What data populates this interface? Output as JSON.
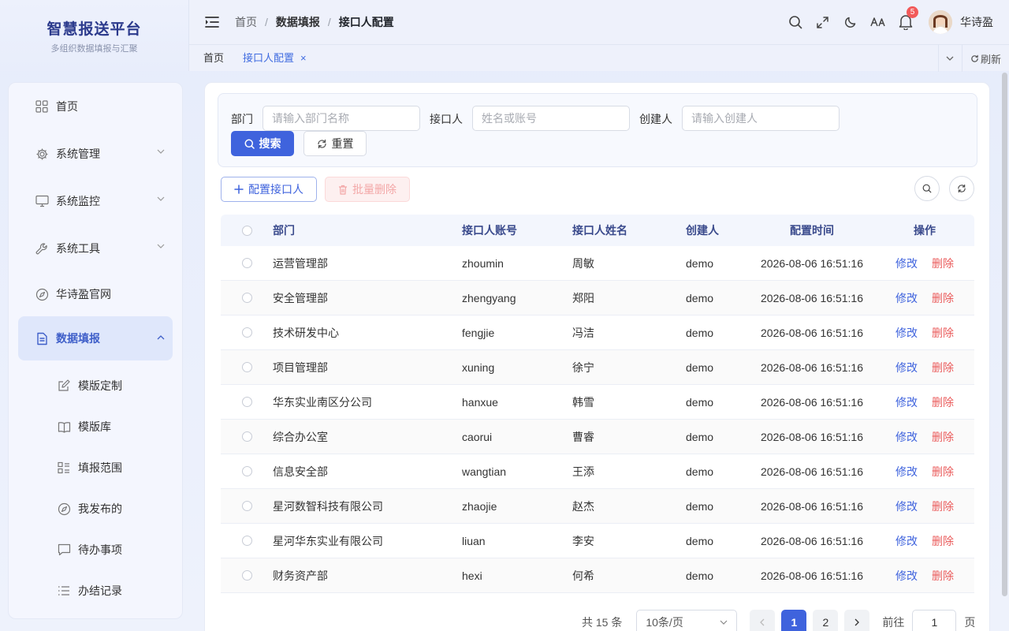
{
  "brand": {
    "title": "智慧报送平台",
    "subtitle": "多组织数据填报与汇聚"
  },
  "breadcrumb": [
    "首页",
    "数据填报",
    "接口人配置"
  ],
  "notifications": {
    "count": "5"
  },
  "user": {
    "name": "华诗盈"
  },
  "tabs": [
    {
      "label": "首页"
    },
    {
      "label": "接口人配置"
    }
  ],
  "tab_close": "×",
  "tab_refresh": "刷新",
  "sidebar": {
    "items": [
      {
        "label": "首页",
        "icon": "grid-icon"
      },
      {
        "label": "系统管理",
        "icon": "gear-icon"
      },
      {
        "label": "系统监控",
        "icon": "monitor-icon"
      },
      {
        "label": "系统工具",
        "icon": "wrench-icon"
      },
      {
        "label": "华诗盈官网",
        "icon": "compass-icon"
      },
      {
        "label": "数据填报",
        "icon": "document-icon"
      }
    ],
    "subitems": [
      {
        "label": "模版定制",
        "icon": "edit-icon"
      },
      {
        "label": "模版库",
        "icon": "book-icon"
      },
      {
        "label": "填报范围",
        "icon": "list-grid-icon"
      },
      {
        "label": "我发布的",
        "icon": "compass-icon"
      },
      {
        "label": "待办事项",
        "icon": "chat-icon"
      },
      {
        "label": "办结记录",
        "icon": "list-icon"
      }
    ]
  },
  "filter": {
    "dept_label": "部门",
    "dept_placeholder": "请输入部门名称",
    "contact_label": "接口人",
    "contact_placeholder": "姓名或账号",
    "creator_label": "创建人",
    "creator_placeholder": "请输入创建人",
    "search_label": "搜索",
    "reset_label": "重置"
  },
  "toolbar": {
    "add_label": "配置接口人",
    "batch_delete_label": "批量删除"
  },
  "table": {
    "headers": [
      "部门",
      "接口人账号",
      "接口人姓名",
      "创建人",
      "配置时间",
      "操作"
    ],
    "edit_label": "修改",
    "delete_label": "删除",
    "rows": [
      {
        "dept": "运营管理部",
        "account": "zhoumin",
        "name": "周敏",
        "creator": "demo",
        "time": "2026-08-06 16:51:16"
      },
      {
        "dept": "安全管理部",
        "account": "zhengyang",
        "name": "郑阳",
        "creator": "demo",
        "time": "2026-08-06 16:51:16"
      },
      {
        "dept": "技术研发中心",
        "account": "fengjie",
        "name": "冯洁",
        "creator": "demo",
        "time": "2026-08-06 16:51:16"
      },
      {
        "dept": "项目管理部",
        "account": "xuning",
        "name": "徐宁",
        "creator": "demo",
        "time": "2026-08-06 16:51:16"
      },
      {
        "dept": "华东实业南区分公司",
        "account": "hanxue",
        "name": "韩雪",
        "creator": "demo",
        "time": "2026-08-06 16:51:16"
      },
      {
        "dept": "综合办公室",
        "account": "caorui",
        "name": "曹睿",
        "creator": "demo",
        "time": "2026-08-06 16:51:16"
      },
      {
        "dept": "信息安全部",
        "account": "wangtian",
        "name": "王添",
        "creator": "demo",
        "time": "2026-08-06 16:51:16"
      },
      {
        "dept": "星河数智科技有限公司",
        "account": "zhaojie",
        "name": "赵杰",
        "creator": "demo",
        "time": "2026-08-06 16:51:16"
      },
      {
        "dept": "星河华东实业有限公司",
        "account": "liuan",
        "name": "李安",
        "creator": "demo",
        "time": "2026-08-06 16:51:16"
      },
      {
        "dept": "财务资产部",
        "account": "hexi",
        "name": "何希",
        "creator": "demo",
        "time": "2026-08-06 16:51:16"
      }
    ]
  },
  "pagination": {
    "total": "共 15 条",
    "page_size": "10条/页",
    "pages": [
      "1",
      "2"
    ],
    "current": "1",
    "goto_prefix": "前往",
    "goto_value": "1",
    "goto_suffix": "页"
  },
  "colors": {
    "accent": "#3f63dd",
    "danger": "#ea5b5b",
    "badge": "#f25a5a"
  }
}
